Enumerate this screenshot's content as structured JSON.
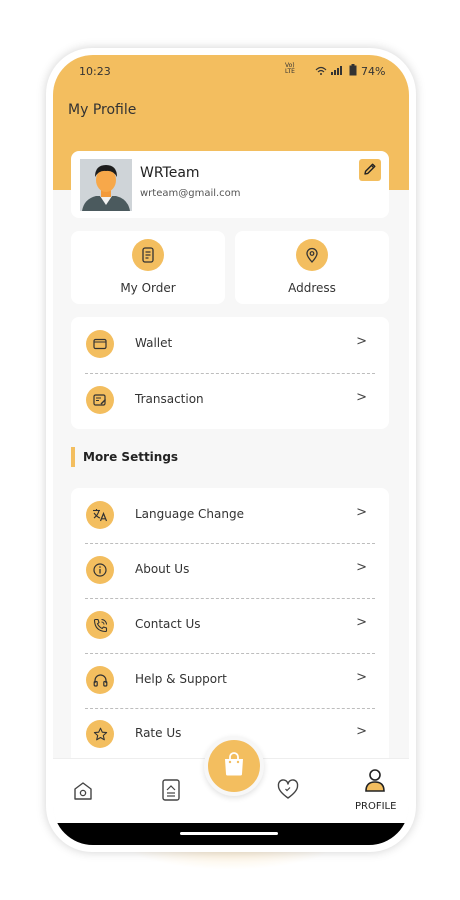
{
  "status_bar": {
    "time": "10:23",
    "network": "Vo) 812.5 LTE KB/s",
    "battery": "74%"
  },
  "header": {
    "title": "My Profile"
  },
  "profile": {
    "name": "WRTeam",
    "email": "wrteam@gmail.com"
  },
  "tiles": [
    {
      "label": "My Order",
      "icon": "receipt-icon"
    },
    {
      "label": "Address",
      "icon": "location-pin-icon"
    }
  ],
  "account_menu": [
    {
      "label": "Wallet",
      "icon": "wallet-icon"
    },
    {
      "label": "Transaction",
      "icon": "transaction-icon"
    }
  ],
  "more_settings": {
    "title": "More Settings",
    "items": [
      {
        "label": "Language Change",
        "icon": "translate-icon"
      },
      {
        "label": "About Us",
        "icon": "info-icon"
      },
      {
        "label": "Contact Us",
        "icon": "phone-icon"
      },
      {
        "label": "Help & Support",
        "icon": "headphones-icon"
      },
      {
        "label": "Rate Us",
        "icon": "star-icon"
      }
    ]
  },
  "chevron": ">",
  "bottom_nav": {
    "active_label": "PROFILE"
  },
  "colors": {
    "accent": "#f3be5f",
    "background": "#f7f7f7"
  }
}
